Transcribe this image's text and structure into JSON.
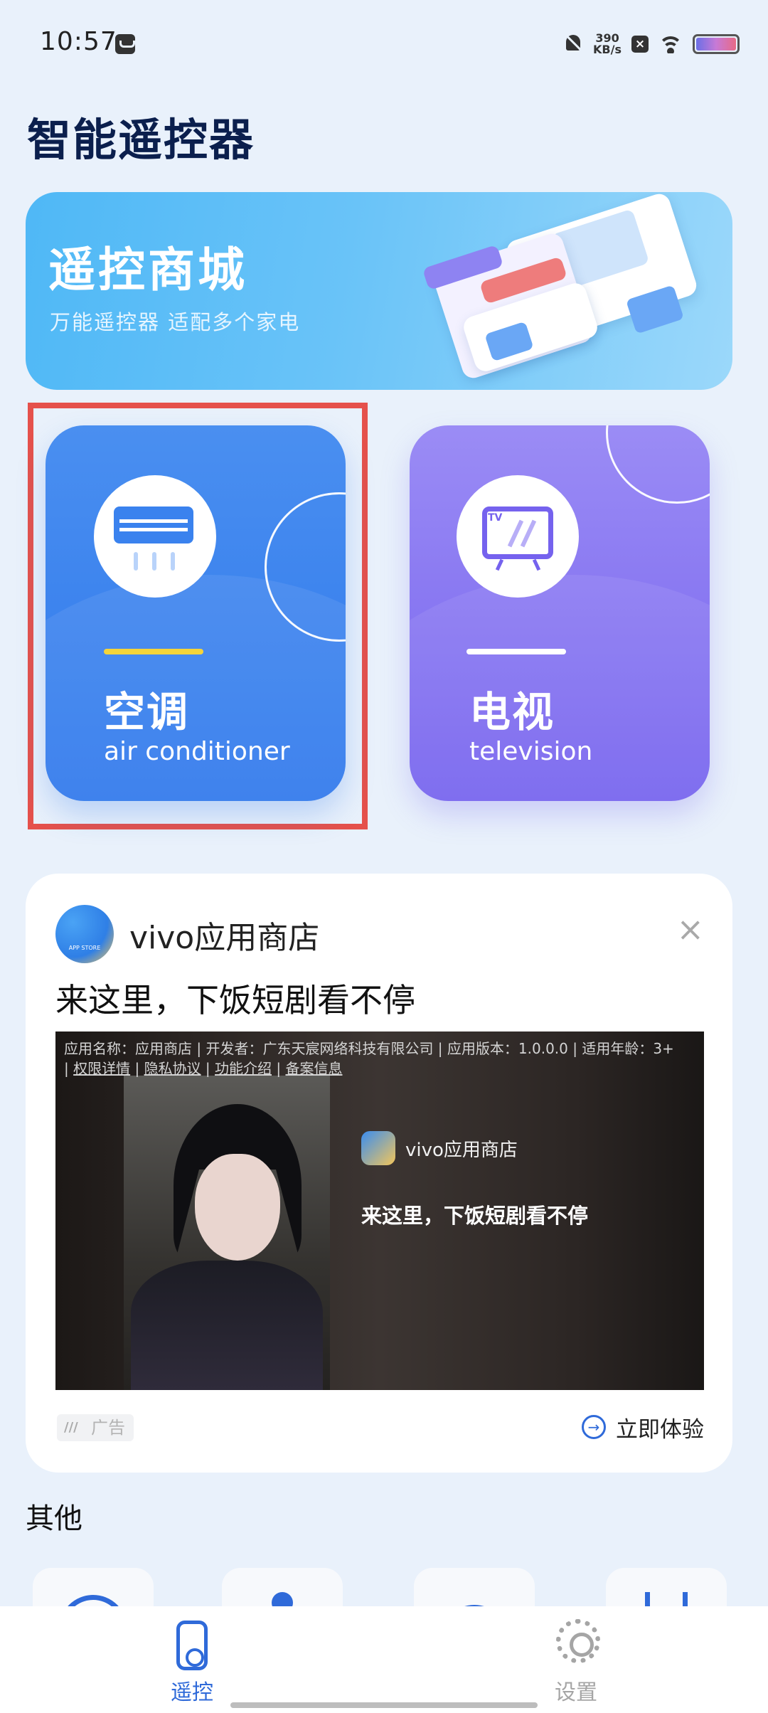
{
  "status_bar": {
    "time": "10:57",
    "net_speed_value": "390",
    "net_speed_unit": "KB/s",
    "x_badge": "×"
  },
  "app": {
    "title": "智能遥控器"
  },
  "banner": {
    "title": "遥控商城",
    "subtitle": "万能遥控器 适配多个家电"
  },
  "categories": [
    {
      "title": "空调",
      "subtitle": "air conditioner",
      "accent": "#f5d43a",
      "color": "#3a82ee"
    },
    {
      "title": "电视",
      "subtitle": "television",
      "accent": "#ffffff",
      "color": "#8675f2"
    }
  ],
  "ad": {
    "app_name": "vivo应用商店",
    "slogan": "来这里，下饭短剧看不停",
    "info_line": "应用名称：应用商店 | 开发者：广东天宸网络科技有限公司 | 应用版本：1.0.0.0 | 适用年龄：3+",
    "links": [
      "权限详情",
      "隐私协议",
      "功能介绍",
      "备案信息"
    ],
    "media_app_name": "vivo应用商店",
    "media_slogan": "来这里，下饭短剧看不停",
    "tag": "广告",
    "cta": "立即体验",
    "close": "×"
  },
  "others": {
    "heading": "其他"
  },
  "bottom_nav": [
    {
      "label": "遥控",
      "active": true,
      "color": "#2f6ad9"
    },
    {
      "label": "设置",
      "active": false,
      "color": "#a5a5a5"
    }
  ]
}
